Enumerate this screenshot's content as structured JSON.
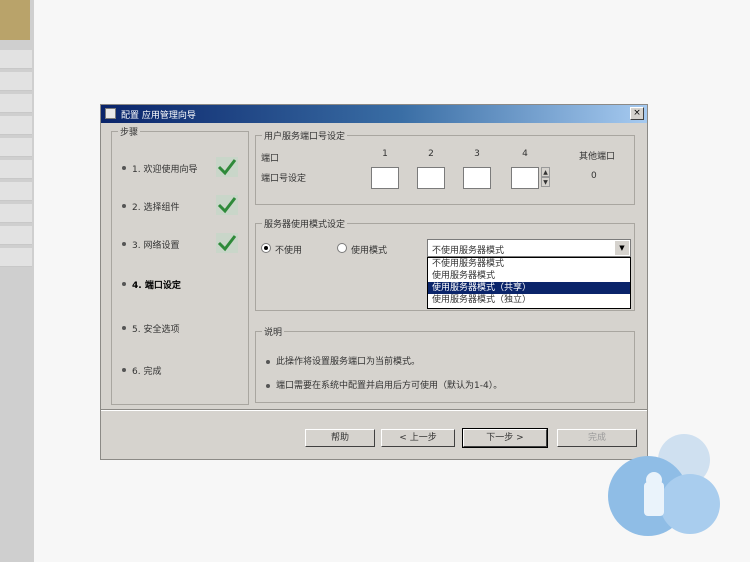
{
  "dialog": {
    "title": "配置 应用管理向导",
    "close_glyph": "×"
  },
  "steps": {
    "group_label": "步骤",
    "items": [
      {
        "label": "1. 欢迎使用向导",
        "done": true,
        "current": false
      },
      {
        "label": "2. 选择组件",
        "done": true,
        "current": false
      },
      {
        "label": "3. 网络设置",
        "done": true,
        "current": false
      },
      {
        "label": "4. 端口设定",
        "done": false,
        "current": true
      },
      {
        "label": "5. 安全选项",
        "done": false,
        "current": false
      },
      {
        "label": "6. 完成",
        "done": false,
        "current": false
      }
    ]
  },
  "port_section": {
    "title": "用户服务端口号设定",
    "row1_label": "端口",
    "row2_label": "端口号设定",
    "columns": [
      "1",
      "2",
      "3",
      "4"
    ],
    "extra_header": "其他端口",
    "extra_value": "0"
  },
  "mode_section": {
    "title": "服务器使用模式设定",
    "option_a": "不使用",
    "option_b": "使用模式",
    "select_value": "不使用服务器模式",
    "options": [
      "不使用服务器模式",
      "使用服务器模式",
      "使用服务器模式（共享）",
      "使用服务器模式（独立）"
    ],
    "selected_index": 2
  },
  "notes_section": {
    "title": "说明",
    "lines": [
      "此操作将设置服务端口为当前模式。",
      "端口需要在系统中配置并启用后方可使用（默认为1-4）。"
    ]
  },
  "buttons": {
    "help": "帮助",
    "back": "< 上一步",
    "next": "下一步 >",
    "finish": "完成"
  }
}
